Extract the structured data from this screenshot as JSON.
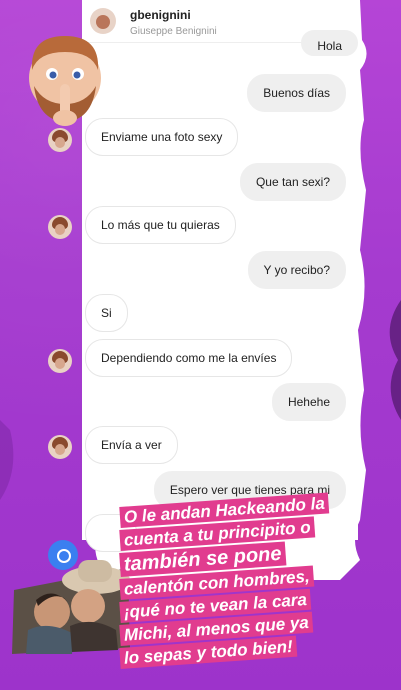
{
  "header": {
    "username": "gbenignini",
    "fullname": "Giuseppe Benignini"
  },
  "messages": [
    {
      "text": "Hola",
      "side": "out"
    },
    {
      "text": "Buenos días",
      "side": "out"
    },
    {
      "text": "Enviame una foto sexy",
      "side": "in"
    },
    {
      "text": "Que tan sexi?",
      "side": "out"
    },
    {
      "text": "Lo más que tu quieras",
      "side": "in"
    },
    {
      "text": "Y yo recibo?",
      "side": "out"
    },
    {
      "text": "Si",
      "side": "in"
    },
    {
      "text": "Dependiendo como me la envíes",
      "side": "in"
    },
    {
      "text": "Hehehe",
      "side": "out"
    },
    {
      "text": "Envía a ver",
      "side": "in"
    },
    {
      "text": "Espero ver que tienes para mi",
      "side": "out"
    }
  ],
  "caption": {
    "lines": [
      "O le andan Hackeando la",
      "cuenta a tu principito o",
      "también  se pone",
      "calentón con hombres,",
      "¡qué no te vean la cara",
      "Michi, al menos que ya",
      "lo sepas y todo bien!"
    ]
  },
  "colors": {
    "background": "#a53bcf",
    "caption_highlight": "#e13c8f",
    "bubble_out": "#efefef"
  }
}
